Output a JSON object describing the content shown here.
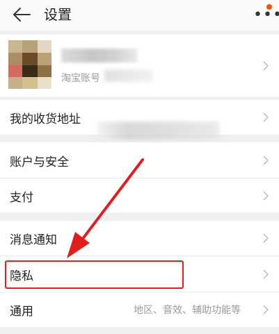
{
  "header": {
    "title": "设置",
    "back_icon": "back-arrow-icon",
    "more_icon": "more-icon",
    "badge_color": "#ff5000"
  },
  "profile": {
    "account_label": "淘宝账号"
  },
  "items": [
    {
      "label": "我的收货地址"
    },
    {
      "label": "账户与安全"
    },
    {
      "label": "支付"
    },
    {
      "label": "消息通知"
    },
    {
      "label": "隐私"
    },
    {
      "label": "通用",
      "value": "地区、音效、辅助功能等"
    }
  ],
  "annotation": {
    "highlight_color": "#e21d1d",
    "arrow_color": "#e21d1d"
  }
}
